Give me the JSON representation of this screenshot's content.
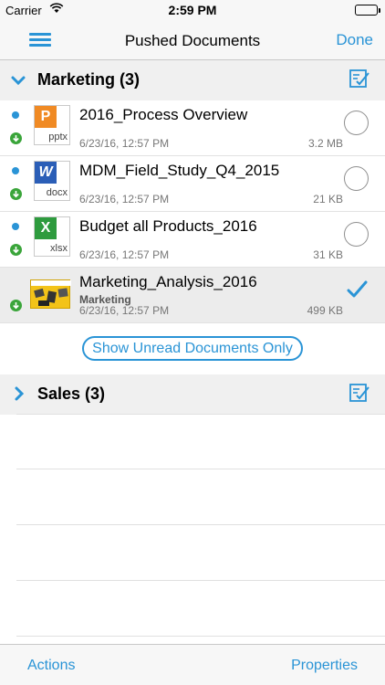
{
  "status_bar": {
    "carrier": "Carrier",
    "time": "2:59 PM"
  },
  "nav": {
    "title": "Pushed Documents",
    "done_label": "Done"
  },
  "sections": [
    {
      "label": "Marketing (3)",
      "expanded": true,
      "documents": [
        {
          "name": "2016_Process Overview",
          "ext": "pptx",
          "badge": "P",
          "badge_color": "#f08a24",
          "date": "6/23/16, 12:57 PM",
          "size": "3.2 MB",
          "unread": true,
          "selected": false
        },
        {
          "name": "MDM_Field_Study_Q4_2015",
          "ext": "docx",
          "badge": "W",
          "badge_color": "#2b5eb7",
          "date": "6/23/16, 12:57 PM",
          "size": "21 KB",
          "unread": true,
          "selected": false
        },
        {
          "name": "Budget all Products_2016",
          "ext": "xlsx",
          "badge": "X",
          "badge_color": "#2e9b3e",
          "date": "6/23/16, 12:57 PM",
          "size": "31 KB",
          "unread": true,
          "selected": false
        },
        {
          "name": "Marketing_Analysis_2016",
          "category": "Marketing",
          "date": "6/23/16, 12:57 PM",
          "size": "499 KB",
          "unread": false,
          "selected": true
        }
      ]
    },
    {
      "label": "Sales (3)",
      "expanded": false
    }
  ],
  "unread_button_label": "Show Unread Documents Only",
  "toolbar": {
    "actions_label": "Actions",
    "properties_label": "Properties"
  },
  "colors": {
    "accent": "#2a94d6",
    "download": "#3aa53a"
  }
}
